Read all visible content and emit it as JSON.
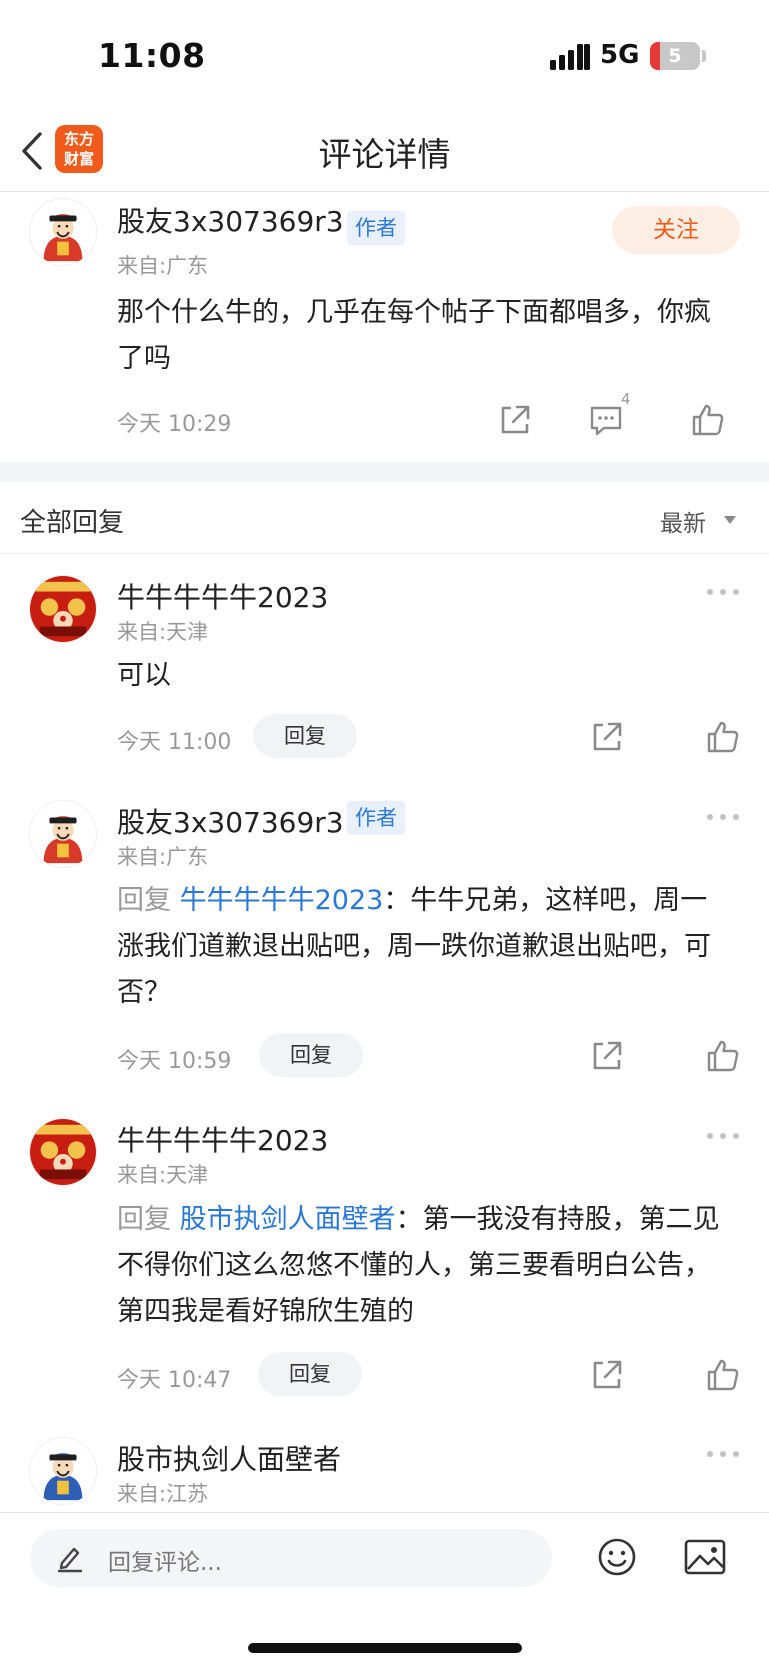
{
  "status_bar": {
    "time": "11:08",
    "network": "5G",
    "battery": "5",
    "battery_level": 0.05
  },
  "nav": {
    "title": "评论详情",
    "logo_line1": "东方",
    "logo_line2": "财富"
  },
  "main_comment": {
    "username": "股友3x307369r3",
    "badge": "作者",
    "location": "来自:广东",
    "follow_label": "关注",
    "content": "那个什么牛的，几乎在每个帖子下面都唱多，你疯了吗",
    "timestamp": "今天 10:29",
    "comment_count": "4"
  },
  "replies_header": {
    "title": "全部回复",
    "sort": "最新"
  },
  "replies": [
    {
      "username": "牛牛牛牛牛2023",
      "location": "来自:天津",
      "content": "可以",
      "timestamp": "今天 11:00",
      "reply_label": "回复"
    },
    {
      "username": "股友3x307369r3",
      "badge": "作者",
      "location": "来自:广东",
      "prefix": "回复 ",
      "mention": "牛牛牛牛牛2023",
      "content": "：牛牛兄弟，这样吧，周一涨我们道歉退出贴吧，周一跌你道歉退出贴吧，可否？",
      "timestamp": "今天 10:59",
      "reply_label": "回复"
    },
    {
      "username": "牛牛牛牛牛2023",
      "location": "来自:天津",
      "prefix": "回复 ",
      "mention": "股市执剑人面壁者",
      "content": "：第一我没有持股，第二见不得你们这么忽悠不懂的人，第三要看明白公告，第四我是看好锦欣生殖的",
      "timestamp": "今天 10:47",
      "reply_label": "回复"
    },
    {
      "username": "股市执剑人面壁者",
      "location": "来自:江苏"
    }
  ],
  "bottom_bar": {
    "placeholder": "回复评论..."
  },
  "colors": {
    "brand": "#f05a1a",
    "mention": "#2a78d6",
    "badge_bg": "#e7f0fb",
    "muted": "#999999"
  }
}
